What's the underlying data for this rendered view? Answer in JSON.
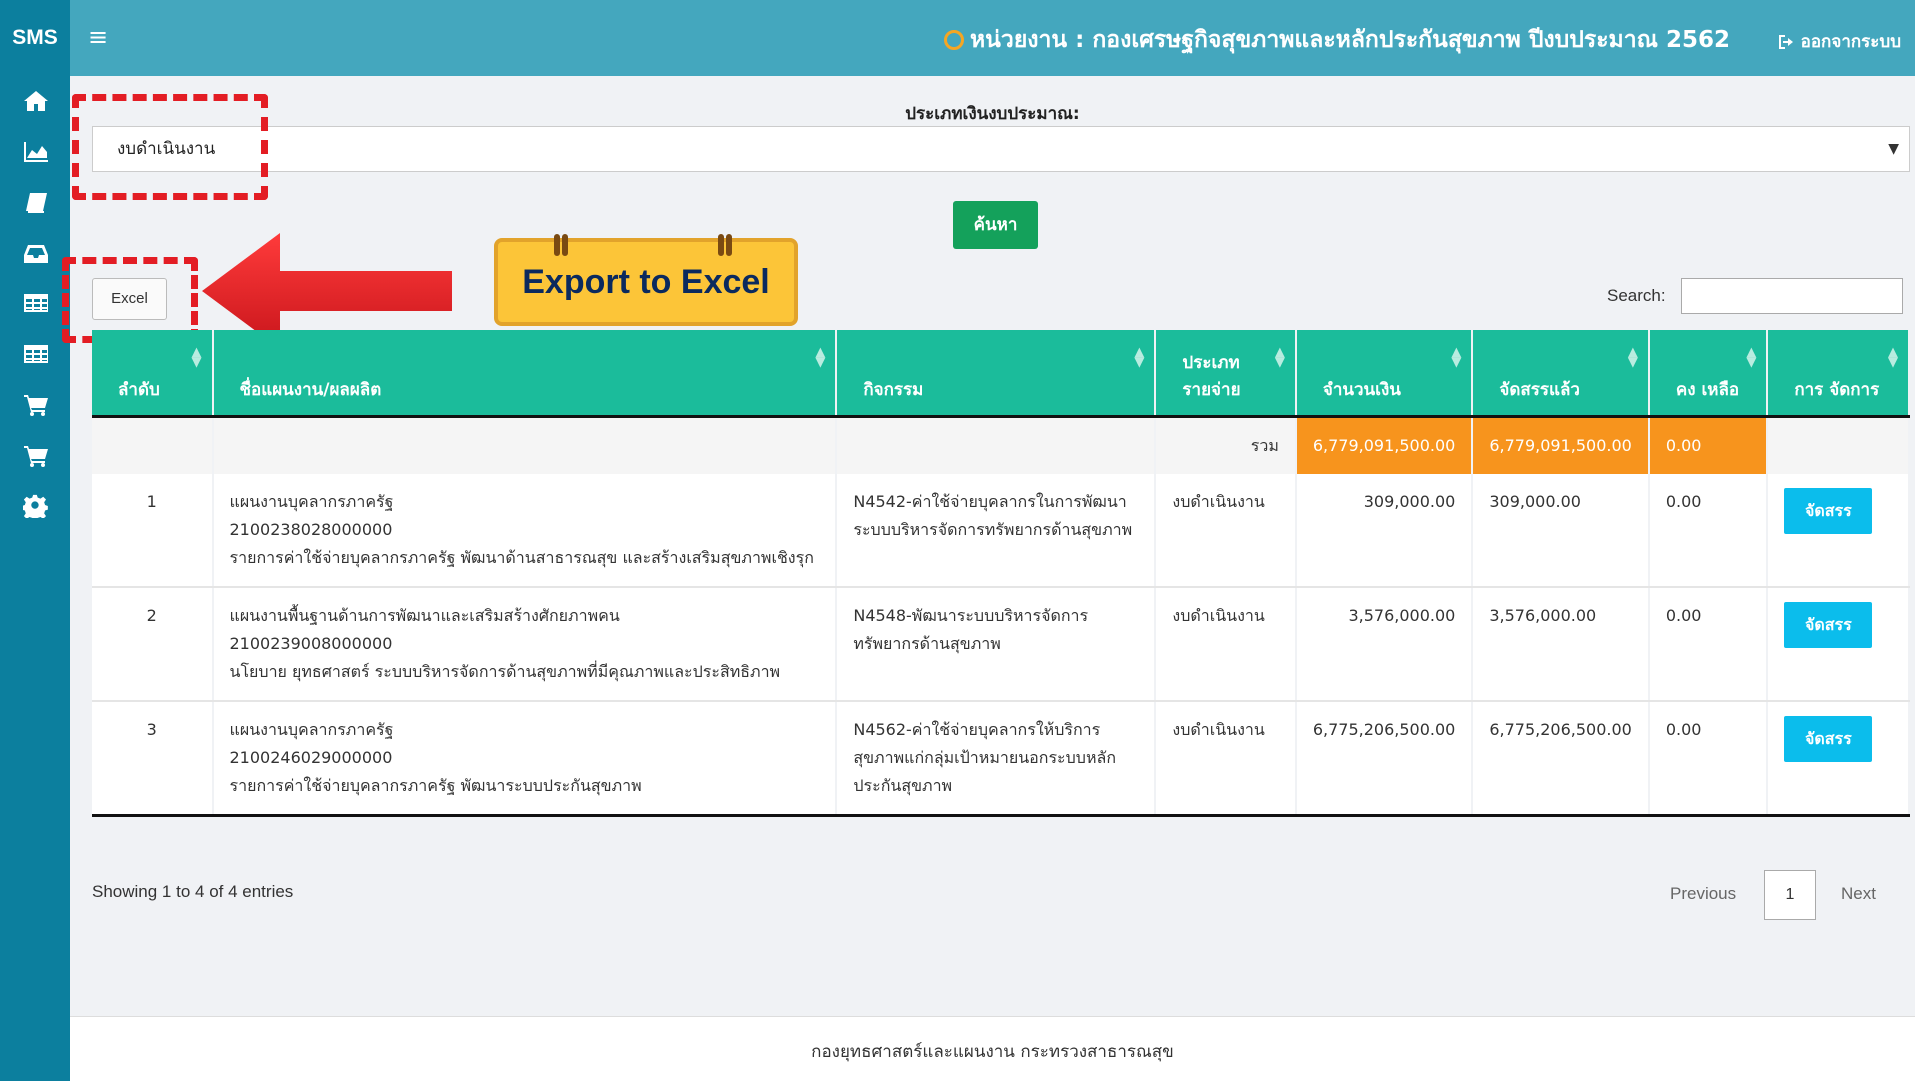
{
  "app": {
    "brand": "SMS"
  },
  "header": {
    "unit_title": "หน่วยงาน : กองเศรษฐกิจสุขภาพและหลักประกันสุขภาพ ปีงบประมาณ 2562",
    "logout_label": "ออกจากระบบ"
  },
  "sidebar": {
    "icons": [
      "home-icon",
      "area-chart-icon",
      "book-icon",
      "inbox-icon",
      "table-icon",
      "table-icon",
      "cart-icon",
      "cart-icon",
      "gear-icon"
    ]
  },
  "filter": {
    "budget_type_label": "ประเภทเงินงบประมาณ:",
    "budget_type_value": "งบดำเนินงาน",
    "search_button": "ค้นหา"
  },
  "toolbar": {
    "excel_button": "Excel",
    "search_label": "Search:",
    "search_value": ""
  },
  "annotation": {
    "callout_text": "Export to Excel",
    "highlight_color": "#e31d24",
    "callout_color": "#fcc538"
  },
  "table": {
    "headers": [
      "ลำดับ",
      "ชื่อแผนงาน/ผลผลิต",
      "กิจกรรม",
      "ประเภท รายจ่าย",
      "จำนวนเงิน",
      "จัดสรรแล้ว",
      "คง เหลือ",
      "การ จัดการ"
    ],
    "total_row": {
      "label": "รวม",
      "amount": "6,779,091,500.00",
      "allocated": "6,779,091,500.00",
      "remaining": "0.00"
    },
    "rows": [
      {
        "no": "1",
        "plan": "แผนงานบุคลากรภาครัฐ",
        "code": "2100238028000000",
        "detail": "รายการค่าใช้จ่ายบุคลากรภาครัฐ พัฒนาด้านสาธารณสุข และสร้างเสริมสุขภาพเชิงรุก",
        "activity": "N4542-ค่าใช้จ่ายบุคลากรในการพัฒนาระบบบริหารจัดการทรัพยากรด้านสุขภาพ",
        "type": "งบดำเนินงาน",
        "amount": "309,000.00",
        "allocated": "309,000.00",
        "remaining": "0.00",
        "action": "จัดสรร"
      },
      {
        "no": "2",
        "plan": "แผนงานพื้นฐานด้านการพัฒนาและเสริมสร้างศักยภาพคน",
        "code": "2100239008000000",
        "detail": "นโยบาย ยุทธศาสตร์ ระบบบริหารจัดการด้านสุขภาพที่มีคุณภาพและประสิทธิภาพ",
        "activity": "N4548-พัฒนาระบบบริหารจัดการทรัพยากรด้านสุขภาพ",
        "type": "งบดำเนินงาน",
        "amount": "3,576,000.00",
        "allocated": "3,576,000.00",
        "remaining": "0.00",
        "action": "จัดสรร"
      },
      {
        "no": "3",
        "plan": "แผนงานบุคลากรภาครัฐ",
        "code": "2100246029000000",
        "detail": "รายการค่าใช้จ่ายบุคลากรภาครัฐ พัฒนาระบบประกันสุขภาพ",
        "activity": "N4562-ค่าใช้จ่ายบุคลากรให้บริการสุขภาพแก่กลุ่มเป้าหมายนอกระบบหลักประกันสุขภาพ",
        "type": "งบดำเนินงาน",
        "amount": "6,775,206,500.00",
        "allocated": "6,775,206,500.00",
        "remaining": "0.00",
        "action": "จัดสรร"
      }
    ]
  },
  "pagination": {
    "info": "Showing 1 to 4 of 4 entries",
    "previous": "Previous",
    "current": "1",
    "next": "Next"
  },
  "footer": {
    "text": "กองยุทธศาสตร์และแผนงาน กระทรวงสาธารณสุข"
  }
}
